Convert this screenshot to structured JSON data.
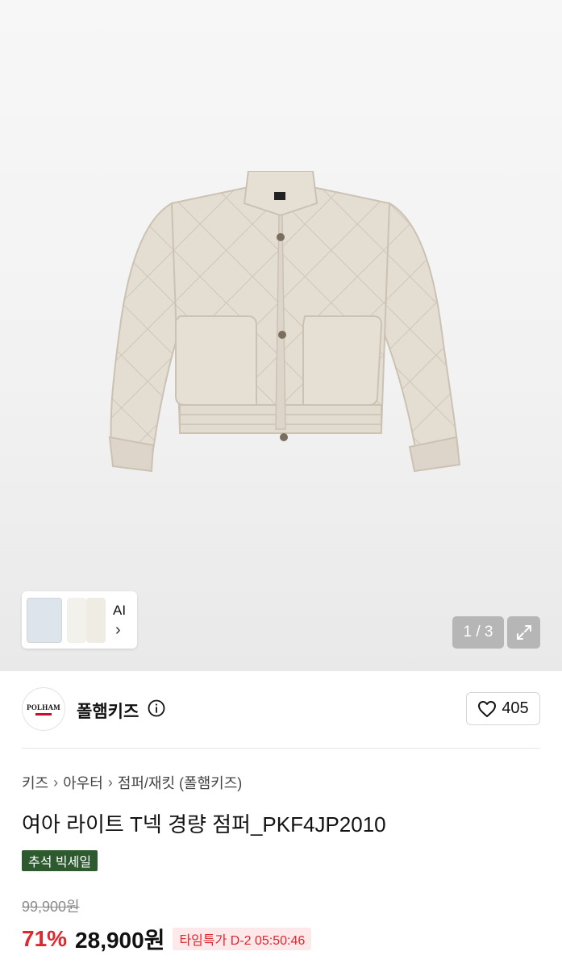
{
  "gallery": {
    "pager": "1 / 3",
    "ai_label": "AI",
    "ai_chevron": "›"
  },
  "brand": {
    "logo_text": "POLHAM",
    "name": "폴햄키즈",
    "likes": "405"
  },
  "breadcrumb": [
    "키즈",
    "아우터",
    "점퍼/재킷 (폴햄키즈)"
  ],
  "breadcrumb_sep": "›",
  "product": {
    "title": "여아 라이트 T넥 경량 점퍼_PKF4JP2010",
    "promo_badge": "추석 빅세일",
    "original_price": "99,900원",
    "discount": "71%",
    "sale_price": "28,900원",
    "time_badge": "타임특가 D-2 05:50:46"
  },
  "colors": {
    "discount_red": "#e0262e",
    "promo_green": "#2d5a2f",
    "jacket_beige": "#e4ddd2"
  },
  "icons": [
    "jacket-product-image",
    "expand-icon",
    "info-icon",
    "heart-icon",
    "chevron-right-icon"
  ]
}
